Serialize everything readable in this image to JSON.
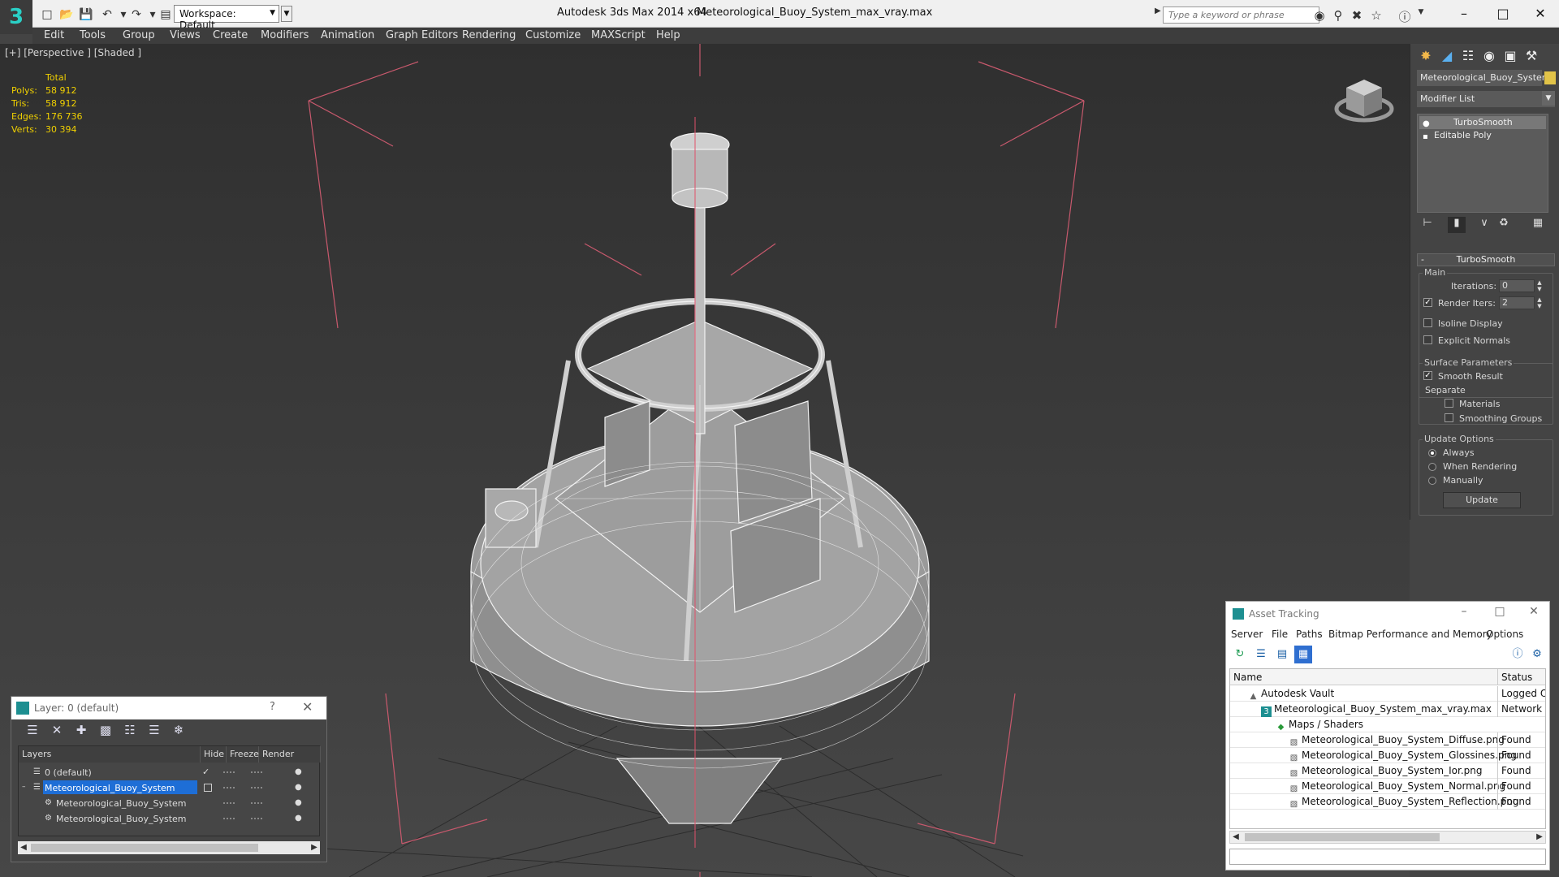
{
  "titlebar": {
    "workspace": "Workspace: Default",
    "app_title": "Autodesk 3ds Max  2014 x64",
    "doc_title": "Meteorological_Buoy_System_max_vray.max",
    "search_placeholder": "Type a keyword or phrase"
  },
  "menu": [
    "Edit",
    "Tools",
    "Group",
    "Views",
    "Create",
    "Modifiers",
    "Animation",
    "Graph Editors",
    "Rendering",
    "Customize",
    "MAXScript",
    "Help"
  ],
  "viewport": {
    "label": "[+] [Perspective ] [Shaded ]",
    "stats": {
      "header": "Total",
      "rows": [
        {
          "k": "Polys:",
          "v": "58 912"
        },
        {
          "k": "Tris:",
          "v": "58 912"
        },
        {
          "k": "Edges:",
          "v": "176 736"
        },
        {
          "k": "Verts:",
          "v": "30 394"
        }
      ]
    }
  },
  "command_panel": {
    "object_name": "Meteorological_Buoy_System",
    "object_color": "#e1c348",
    "modifier_list": "Modifier List",
    "stack": [
      {
        "label": "TurboSmooth",
        "selected": true
      },
      {
        "label": "Editable Poly",
        "selected": false
      }
    ],
    "rollout_title": "TurboSmooth",
    "main_group": "Main",
    "iterations_label": "Iterations:",
    "iterations_value": "0",
    "render_iters_label": "Render Iters:",
    "render_iters_value": "2",
    "isoline_label": "Isoline Display",
    "explicit_normals_label": "Explicit Normals",
    "surface_group": "Surface Parameters",
    "smooth_result_label": "Smooth Result",
    "separate_label": "Separate",
    "materials_label": "Materials",
    "smoothing_groups_label": "Smoothing Groups",
    "update_group": "Update Options",
    "always_label": "Always",
    "when_rendering_label": "When Rendering",
    "manually_label": "Manually",
    "update_button": "Update"
  },
  "layer_dialog": {
    "title": "Layer: 0 (default)",
    "help": "?",
    "columns": [
      "Layers",
      "Hide",
      "Freeze",
      "Render"
    ],
    "rows": [
      {
        "name": "0 (default)",
        "selected": false
      },
      {
        "name": "Meteorological_Buoy_System",
        "selected": true
      },
      {
        "name": "Meteorological_Buoy_System",
        "selected": false
      },
      {
        "name": "Meteorological_Buoy_System",
        "selected": false
      }
    ]
  },
  "asset_tracking": {
    "title": "Asset Tracking",
    "menu": [
      "Server",
      "File",
      "Paths",
      "Bitmap Performance and Memory",
      "Options"
    ],
    "columns": [
      "Name",
      "Status"
    ],
    "rows": [
      {
        "name": "Autodesk Vault",
        "status": "Logged Out",
        "indent": 1
      },
      {
        "name": "Meteorological_Buoy_System_max_vray.max",
        "status": "Network P",
        "indent": 2
      },
      {
        "name": "Maps / Shaders",
        "status": "",
        "indent": 3
      },
      {
        "name": "Meteorological_Buoy_System_Diffuse.png",
        "status": "Found",
        "indent": 4
      },
      {
        "name": "Meteorological_Buoy_System_Glossines.png",
        "status": "Found",
        "indent": 4
      },
      {
        "name": "Meteorological_Buoy_System_Ior.png",
        "status": "Found",
        "indent": 4
      },
      {
        "name": "Meteorological_Buoy_System_Normal.png",
        "status": "Found",
        "indent": 4
      },
      {
        "name": "Meteorological_Buoy_System_Reflection.png",
        "status": "Found",
        "indent": 4
      }
    ]
  }
}
